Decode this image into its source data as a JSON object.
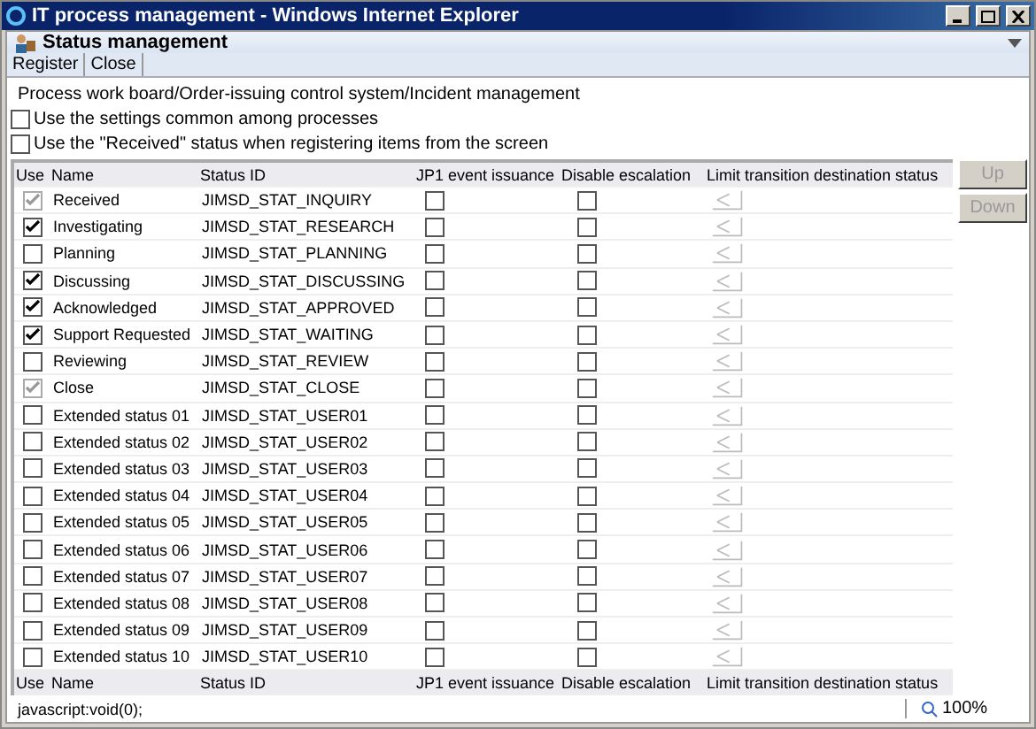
{
  "window": {
    "title": "IT process management - Windows Internet Explorer"
  },
  "page_title": "Status management",
  "toolbar": [
    "Register",
    "Close"
  ],
  "breadcrumb": "Process work board/Order-issuing control system/Incident management",
  "options": [
    {
      "label": "Use the settings common among processes",
      "checked": false
    },
    {
      "label": "Use the \"Received\" status when registering items from the screen",
      "checked": false
    }
  ],
  "table": {
    "columns": [
      "Use",
      "Name",
      "Status ID",
      "JP1 event issuance",
      "Disable escalation",
      "Limit transition destination status"
    ],
    "rows": [
      {
        "use": {
          "checked": true,
          "disabled": true
        },
        "name": "Received",
        "status_id": "JIMSD_STAT_INQUIRY",
        "jp1": false,
        "disable_escalation": false
      },
      {
        "use": {
          "checked": true,
          "disabled": false
        },
        "name": "Investigating",
        "status_id": "JIMSD_STAT_RESEARCH",
        "jp1": false,
        "disable_escalation": false
      },
      {
        "use": {
          "checked": false,
          "disabled": false
        },
        "name": "Planning",
        "status_id": "JIMSD_STAT_PLANNING",
        "jp1": false,
        "disable_escalation": false
      },
      {
        "use": {
          "checked": true,
          "disabled": false
        },
        "name": "Discussing",
        "status_id": "JIMSD_STAT_DISCUSSING",
        "jp1": false,
        "disable_escalation": false
      },
      {
        "use": {
          "checked": true,
          "disabled": false
        },
        "name": "Acknowledged",
        "status_id": "JIMSD_STAT_APPROVED",
        "jp1": false,
        "disable_escalation": false
      },
      {
        "use": {
          "checked": true,
          "disabled": false
        },
        "name": "Support Requested",
        "status_id": "JIMSD_STAT_WAITING",
        "jp1": false,
        "disable_escalation": false
      },
      {
        "use": {
          "checked": false,
          "disabled": false
        },
        "name": "Reviewing",
        "status_id": "JIMSD_STAT_REVIEW",
        "jp1": false,
        "disable_escalation": false
      },
      {
        "use": {
          "checked": true,
          "disabled": true
        },
        "name": "Close",
        "status_id": "JIMSD_STAT_CLOSE",
        "jp1": false,
        "disable_escalation": false
      },
      {
        "use": {
          "checked": false,
          "disabled": false
        },
        "name": "Extended status 01",
        "status_id": "JIMSD_STAT_USER01",
        "jp1": false,
        "disable_escalation": false
      },
      {
        "use": {
          "checked": false,
          "disabled": false
        },
        "name": "Extended status 02",
        "status_id": "JIMSD_STAT_USER02",
        "jp1": false,
        "disable_escalation": false
      },
      {
        "use": {
          "checked": false,
          "disabled": false
        },
        "name": "Extended status 03",
        "status_id": "JIMSD_STAT_USER03",
        "jp1": false,
        "disable_escalation": false
      },
      {
        "use": {
          "checked": false,
          "disabled": false
        },
        "name": "Extended status 04",
        "status_id": "JIMSD_STAT_USER04",
        "jp1": false,
        "disable_escalation": false
      },
      {
        "use": {
          "checked": false,
          "disabled": false
        },
        "name": "Extended status 05",
        "status_id": "JIMSD_STAT_USER05",
        "jp1": false,
        "disable_escalation": false
      },
      {
        "use": {
          "checked": false,
          "disabled": false
        },
        "name": "Extended status 06",
        "status_id": "JIMSD_STAT_USER06",
        "jp1": false,
        "disable_escalation": false
      },
      {
        "use": {
          "checked": false,
          "disabled": false
        },
        "name": "Extended status 07",
        "status_id": "JIMSD_STAT_USER07",
        "jp1": false,
        "disable_escalation": false
      },
      {
        "use": {
          "checked": false,
          "disabled": false
        },
        "name": "Extended status 08",
        "status_id": "JIMSD_STAT_USER08",
        "jp1": false,
        "disable_escalation": false
      },
      {
        "use": {
          "checked": false,
          "disabled": false
        },
        "name": "Extended status 09",
        "status_id": "JIMSD_STAT_USER09",
        "jp1": false,
        "disable_escalation": false
      },
      {
        "use": {
          "checked": false,
          "disabled": false
        },
        "name": "Extended status 10",
        "status_id": "JIMSD_STAT_USER10",
        "jp1": false,
        "disable_escalation": false
      }
    ],
    "footer_columns": [
      "Use",
      "Name",
      "Status ID",
      "JP1 event issuance",
      "Disable escalation",
      "Limit transition destination status"
    ]
  },
  "side_buttons": [
    {
      "label": "Up",
      "disabled": true
    },
    {
      "label": "Down",
      "disabled": true
    }
  ],
  "status_bar": {
    "text": "javascript:void(0);",
    "zoom": "100%"
  }
}
